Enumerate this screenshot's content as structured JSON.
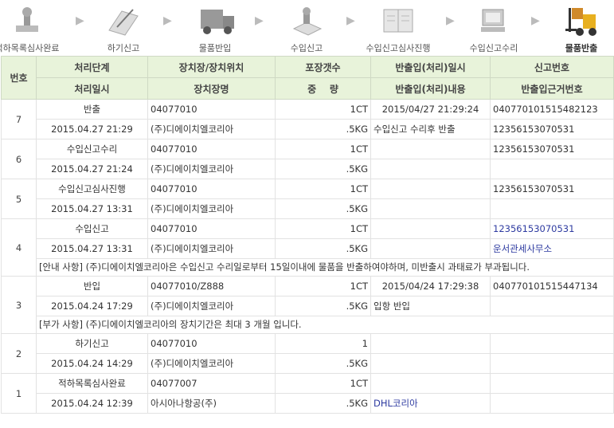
{
  "steps": [
    {
      "label": "적하목록심사완료",
      "icon": "stamp-icon"
    },
    {
      "label": "하기신고",
      "icon": "document-pen-icon"
    },
    {
      "label": "물품반입",
      "icon": "truck-icon"
    },
    {
      "label": "수입신고",
      "icon": "stamp-document-icon"
    },
    {
      "label": "수입신고심사진행",
      "icon": "open-book-icon"
    },
    {
      "label": "수입신고수리",
      "icon": "computer-icon"
    },
    {
      "label": "물품반출",
      "icon": "forklift-icon"
    }
  ],
  "table": {
    "headers": {
      "no": "번호",
      "stage": "처리단계",
      "loc": "장치장/장치위치",
      "pkg": "포장갯수",
      "inout_dt": "반출입(처리)일시",
      "decl": "신고번호",
      "date": "처리일시",
      "loc_name": "장치장명",
      "weight": "중    량",
      "inout_desc": "반출입(처리)내용",
      "basis": "반출입근거번호"
    },
    "rows": [
      {
        "no": "7",
        "stage": "반출",
        "loc": "04077010",
        "pkg": "1CT",
        "inout_dt": "2015/04/27 21:29:24",
        "decl": "040770101515482123",
        "date": "2015.04.27 21:29",
        "loc_name": "(주)디에이치엘코리아",
        "weight": ".5KG",
        "inout_desc": "수입신고 수리후 반출",
        "basis": "12356153070531"
      },
      {
        "no": "6",
        "stage": "수입신고수리",
        "loc": "04077010",
        "pkg": "1CT",
        "inout_dt": "",
        "decl": "12356153070531",
        "date": "2015.04.27 21:24",
        "loc_name": "(주)디에이치엘코리아",
        "weight": ".5KG",
        "inout_desc": "",
        "basis": ""
      },
      {
        "no": "5",
        "stage": "수입신고심사진행",
        "loc": "04077010",
        "pkg": "1CT",
        "inout_dt": "",
        "decl": "12356153070531",
        "date": "2015.04.27 13:31",
        "loc_name": "(주)디에이치엘코리아",
        "weight": ".5KG",
        "inout_desc": "",
        "basis": ""
      },
      {
        "no": "4",
        "stage": "수입신고",
        "loc": "04077010",
        "pkg": "1CT",
        "inout_dt": "",
        "decl": "12356153070531",
        "date": "2015.04.27 13:31",
        "loc_name": "(주)디에이치엘코리아",
        "weight": ".5KG",
        "inout_desc": "",
        "basis": "운서관세사무소",
        "note": "[안내 사항] (주)디에이치엘코리아은 수입신고 수리일로부터 15일이내에 물품을 반출하여야하며, 미반출시 과태료가 부과됩니다."
      },
      {
        "no": "3",
        "stage": "반입",
        "loc": "04077010/Z888",
        "pkg": "1CT",
        "inout_dt": "2015/04/24 17:29:38",
        "decl": "040770101515447134",
        "date": "2015.04.24 17:29",
        "loc_name": "(주)디에이치엘코리아",
        "weight": ".5KG",
        "inout_desc": "입항 반입",
        "basis": "",
        "note": "[부가 사항] (주)디에이치엘코리아의 장치기간은 최대 3 개월 입니다."
      },
      {
        "no": "2",
        "stage": "하기신고",
        "loc": "04077010",
        "pkg": "1",
        "inout_dt": "",
        "decl": "",
        "date": "2015.04.24 14:29",
        "loc_name": "(주)디에이치엘코리아",
        "weight": ".5KG",
        "inout_desc": "",
        "basis": ""
      },
      {
        "no": "1",
        "stage": "적하목록심사완료",
        "loc": "04077007",
        "pkg": "1CT",
        "inout_dt": "",
        "decl": "",
        "date": "2015.04.24 12:39",
        "loc_name": "아시아나항공(주)",
        "weight": ".5KG",
        "inout_desc": "DHL코리아",
        "basis": ""
      }
    ]
  }
}
